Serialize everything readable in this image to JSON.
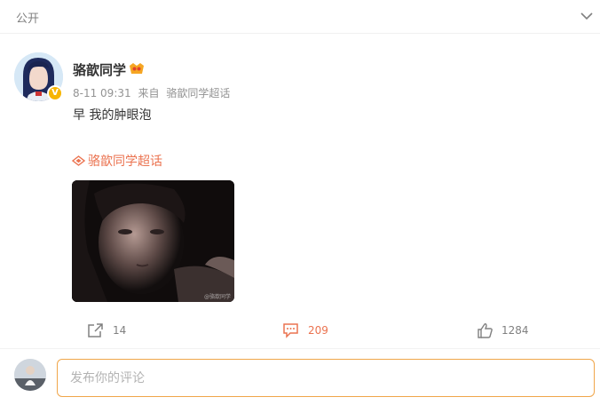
{
  "header": {
    "visibility": "公开",
    "collapse_icon": "chevron-down-icon"
  },
  "post": {
    "author": "骆歆同学",
    "timestamp": "8-11 09:31",
    "source_prefix": "来自",
    "source_name": "骆歆同学超话",
    "text": "早 我的肿眼泡",
    "topic": "骆歆同学超话",
    "photo_watermark": "@骆歆同学"
  },
  "actions": {
    "share_count": "14",
    "comment_count": "209",
    "like_count": "1284"
  },
  "comment_box": {
    "placeholder": "发布你的评论"
  },
  "colors": {
    "accent": "#eb7350",
    "input_border": "#f0a64a",
    "muted": "#939393",
    "verified": "#f7b500"
  }
}
